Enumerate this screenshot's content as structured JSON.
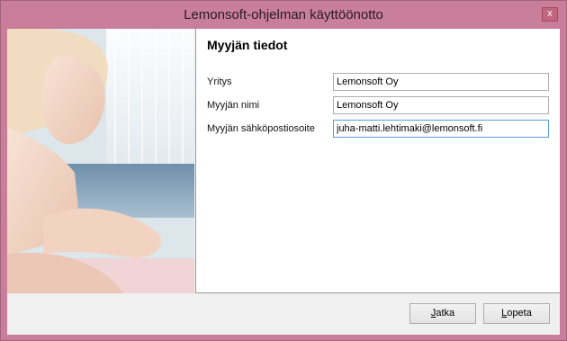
{
  "window": {
    "title": "Lemonsoft-ohjelman käyttöönotto",
    "close_glyph": "x"
  },
  "section": {
    "title": "Myyjän tiedot"
  },
  "fields": [
    {
      "label": "Yritys",
      "value": "Lemonsoft Oy"
    },
    {
      "label": "Myyjän nimi",
      "value": "Lemonsoft Oy"
    },
    {
      "label": "Myyjän sähköpostiosoite",
      "value": "juha-matti.lehtimaki@lemonsoft.fi"
    }
  ],
  "buttons": {
    "next": {
      "mnemonic": "J",
      "rest": "atka"
    },
    "quit": {
      "mnemonic": "L",
      "rest": "opeta"
    }
  },
  "colors": {
    "frame": "#c97f9a",
    "focus_border": "#569de5"
  }
}
